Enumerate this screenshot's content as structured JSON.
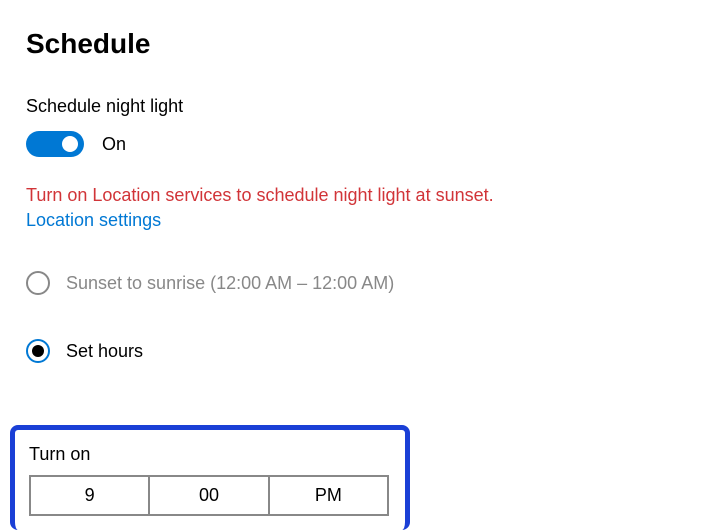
{
  "schedule": {
    "heading": "Schedule",
    "toggle_label": "Schedule night light",
    "toggle_state": "On",
    "warning": "Turn on Location services to schedule night light at sunset.",
    "link": "Location settings",
    "radio_options": {
      "sunset": "Sunset to sunrise (12:00 AM – 12:00 AM)",
      "set_hours": "Set hours"
    },
    "turn_on": {
      "label": "Turn on",
      "hour": "9",
      "minute": "00",
      "period": "PM"
    }
  }
}
